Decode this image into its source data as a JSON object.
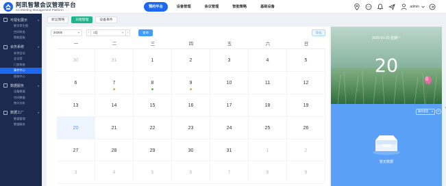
{
  "app": {
    "title": "阿凯智慧会议管理平台",
    "subtitle": "Cx Meeting Management Platform"
  },
  "nav": [
    {
      "label": "预约平台"
    },
    {
      "label": "设备管理"
    },
    {
      "label": "会议管理"
    },
    {
      "label": "智能策略"
    },
    {
      "label": "基础设备"
    }
  ],
  "user": {
    "name": "admin"
  },
  "sidebar": {
    "groups": [
      {
        "label": "可视化展示",
        "items": [
          "数字孪生图",
          "空间状态",
          "智能面板"
        ]
      },
      {
        "label": "会务系统",
        "items": [
          "安排会议",
          "会议室",
          "门禁系统",
          "事件中心",
          "报修中心"
        ]
      },
      {
        "label": "数据服务",
        "items": [
          "设备数据",
          "空间数据",
          "统计分析"
        ]
      },
      {
        "label": "数据工厂",
        "items": [
          "数据管理",
          "数据服务"
        ]
      }
    ],
    "active_item": "事件中心"
  },
  "tabs": [
    {
      "label": "新运策略"
    },
    {
      "label": "日程管理"
    },
    {
      "label": "设备事件"
    }
  ],
  "toolbar": {
    "year": "2025年",
    "month": "1月",
    "prev": "‹",
    "next": "›",
    "query_label": "查询",
    "export_label": "导出"
  },
  "calendar": {
    "weekdays": [
      "一",
      "二",
      "三",
      "四",
      "五",
      "六",
      "日"
    ],
    "weeks": [
      [
        {
          "d": "30",
          "o": true
        },
        {
          "d": "31",
          "o": true
        },
        {
          "d": "1"
        },
        {
          "d": "2"
        },
        {
          "d": "3"
        },
        {
          "d": "4"
        },
        {
          "d": "5"
        }
      ],
      [
        {
          "d": "6"
        },
        {
          "d": "7",
          "dot": "orange"
        },
        {
          "d": "8",
          "dot": "green"
        },
        {
          "d": "9",
          "dot": "orange"
        },
        {
          "d": "10"
        },
        {
          "d": "11"
        },
        {
          "d": "12"
        }
      ],
      [
        {
          "d": "13"
        },
        {
          "d": "14"
        },
        {
          "d": "15"
        },
        {
          "d": "16"
        },
        {
          "d": "17"
        },
        {
          "d": "18"
        },
        {
          "d": "19"
        }
      ],
      [
        {
          "d": "20",
          "today": true
        },
        {
          "d": "21"
        },
        {
          "d": "22"
        },
        {
          "d": "23"
        },
        {
          "d": "24"
        },
        {
          "d": "25"
        },
        {
          "d": "26"
        }
      ],
      [
        {
          "d": "27"
        },
        {
          "d": "28"
        },
        {
          "d": "29"
        },
        {
          "d": "30"
        },
        {
          "d": "31"
        },
        {
          "d": "1",
          "o": true
        },
        {
          "d": "2",
          "o": true
        }
      ],
      [
        {
          "d": "3",
          "o": true
        },
        {
          "d": "4",
          "o": true
        },
        {
          "d": "5",
          "o": true
        },
        {
          "d": "6",
          "o": true
        },
        {
          "d": "7",
          "o": true
        },
        {
          "d": "8",
          "o": true
        },
        {
          "d": "9",
          "o": true
        }
      ]
    ]
  },
  "selected": {
    "date_line": "2025-01-20 星期一",
    "day": "20"
  },
  "event_panel": {
    "type_select": "事件类型",
    "add": "+",
    "empty_text": "暂无数据"
  },
  "colors": {
    "primary": "#1e68f0",
    "tab_active": "#21b38a",
    "dot_orange": "#f5a623",
    "dot_green": "#52c41a",
    "sidebar_bg": "#1b2a4e",
    "panel_blue": "#5aa0f7"
  }
}
